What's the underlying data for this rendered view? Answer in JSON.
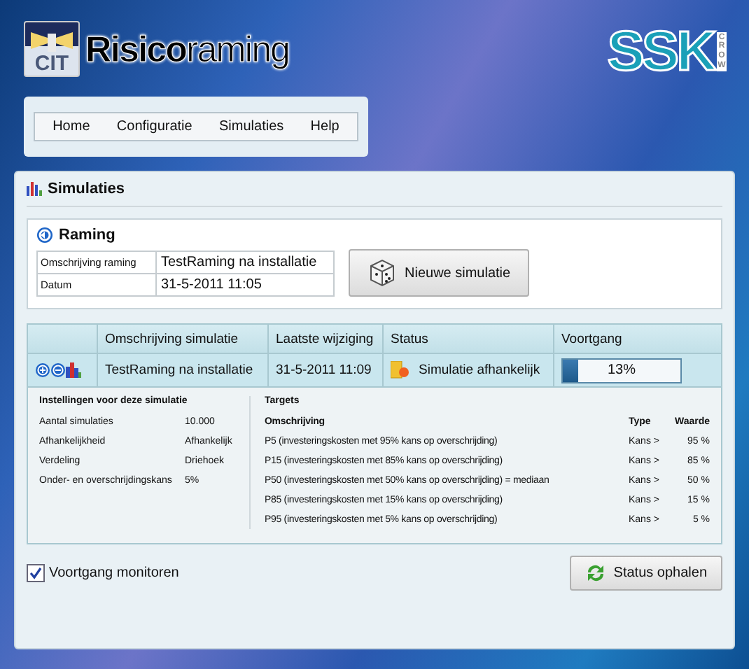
{
  "header": {
    "logo_badge": "CIT",
    "app_name": "**Risico**raming",
    "partner_logo": "SSK",
    "partner_sub": "CROW"
  },
  "menu": [
    "Home",
    "Configuratie",
    "Simulaties",
    "Help"
  ],
  "panel": {
    "title": "Simulaties",
    "raming": {
      "title": "Raming",
      "fields": [
        {
          "label": "Omschrijving raming",
          "value": "TestRaming na installatie"
        },
        {
          "label": "Datum",
          "value": "31-5-2011 11:05"
        }
      ],
      "button": "Nieuwe simulatie"
    },
    "table": {
      "columns": [
        "Omschrijving simulatie",
        "Laatste wijziging",
        "Status",
        "Voortgang"
      ],
      "rows": [
        {
          "description": "TestRaming na installatie",
          "modified": "31-5-2011 11:09",
          "status": "Simulatie afhankelijk",
          "level": 0.13,
          "progress": "13%"
        }
      ]
    },
    "settings": {
      "title": "Instellingen voor deze simulatie",
      "rows": [
        {
          "label": "Aantal simulaties",
          "value": "10.000"
        },
        {
          "label": "Afhankelijkheid",
          "value": "Afhankelijk"
        },
        {
          "label": "Verdeling",
          "value": "Driehoek"
        },
        {
          "label": "Onder- en overschrijdingskans",
          "value": "5%"
        }
      ]
    },
    "targets": {
      "title": "Targets",
      "columns": [
        "Omschrijving",
        "Type",
        "Waarde"
      ],
      "rows": [
        {
          "description": "P5 (investeringskosten met 95% kans op overschrijding)",
          "type": "Kans >",
          "value": "95 %"
        },
        {
          "description": "P15 (investeringskosten met 85% kans op overschrijding)",
          "type": "Kans >",
          "value": "85 %"
        },
        {
          "description": "P50 (investeringskosten met 50% kans op overschrijding) = mediaan",
          "type": "Kans >",
          "value": "50 %"
        },
        {
          "description": "P85 (investeringskosten met 15% kans op overschrijding)",
          "type": "Kans >",
          "value": "15 %"
        },
        {
          "description": "P95 (investeringskosten met 5% kans op overschrijding)",
          "type": "Kans >",
          "value": "5 %"
        }
      ]
    },
    "monitor": {
      "label": "Voortgang monitoren",
      "checked": true
    },
    "refresh_button": "Status ophalen"
  }
}
